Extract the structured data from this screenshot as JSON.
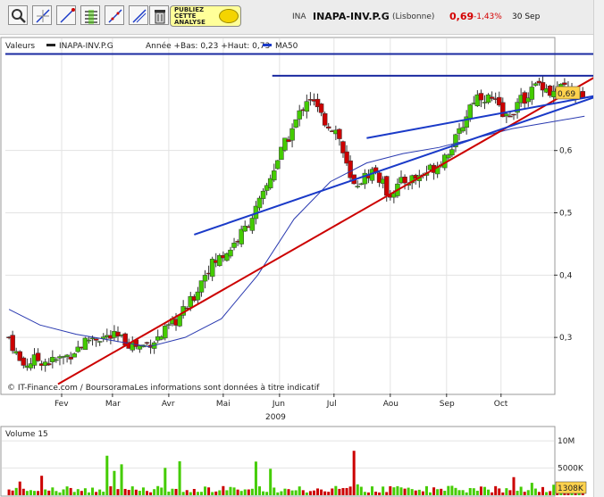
{
  "toolbar": {
    "tools": [
      {
        "name": "zoom-tool-icon"
      },
      {
        "name": "cursor-tool-icon"
      },
      {
        "name": "line-tool-icon"
      },
      {
        "name": "parallel-lines-tool-icon"
      },
      {
        "name": "fibonacci-tool-icon"
      },
      {
        "name": "move-tool-icon"
      },
      {
        "name": "pencil-tool-icon"
      },
      {
        "name": "trash-icon"
      }
    ],
    "ad": {
      "line1": "PUBLIEZ",
      "line2": "CETTE",
      "line3": "ANALYSE"
    }
  },
  "header": {
    "code": "INA",
    "name": "INAPA-INV.P.G",
    "exchange": "(Lisbonne)",
    "price": "0,69",
    "change": "-1,43%",
    "date": "30 Sep",
    "price_color": "#d40000"
  },
  "legend": {
    "valeurs": "Valeurs",
    "series_name": "INAPA-INV.P.G",
    "range_text": "Année +Bas: 0,23 +Haut: 0,73",
    "ma_label": "MA50"
  },
  "price_tag": "0,69",
  "credit": "© IT-Finance.com / BoursoramaLes informations sont données à titre indicatif",
  "volume_panel": {
    "label": "Volume 15",
    "current_value": "1308K"
  },
  "colors": {
    "up": "#44cc00",
    "down": "#cc0000",
    "trend_red": "#cc0000",
    "trend_blue": "#1a3ac8",
    "ma": "#2a3ab0",
    "tag_bg": "#ffd24d"
  },
  "chart_data": {
    "type": "candlestick",
    "year": "2009",
    "x_tick_labels": [
      "Fev",
      "Mar",
      "Avr",
      "Mai",
      "Jun",
      "Jul",
      "Aou",
      "Sep",
      "Oct"
    ],
    "x_tick_days": [
      32,
      60,
      91,
      121,
      152,
      182,
      213,
      244,
      274
    ],
    "x_range_days": [
      1,
      282
    ],
    "y_range": [
      0.21,
      0.78
    ],
    "y_ticks": [
      0.3,
      0.4,
      0.5,
      0.6
    ],
    "y_tick_labels": [
      "0,3",
      "0,4",
      "0,5",
      "0,6"
    ],
    "grid": true,
    "legend_position": "top-left",
    "price_series": {
      "name": "INAPA-INV.P.G",
      "close_points": [
        [
          3,
          0.3
        ],
        [
          10,
          0.255
        ],
        [
          18,
          0.265
        ],
        [
          26,
          0.26
        ],
        [
          35,
          0.27
        ],
        [
          48,
          0.3
        ],
        [
          62,
          0.3
        ],
        [
          75,
          0.285
        ],
        [
          86,
          0.3
        ],
        [
          96,
          0.33
        ],
        [
          104,
          0.36
        ],
        [
          112,
          0.41
        ],
        [
          124,
          0.44
        ],
        [
          132,
          0.47
        ],
        [
          142,
          0.52
        ],
        [
          150,
          0.58
        ],
        [
          160,
          0.64
        ],
        [
          168,
          0.69
        ],
        [
          176,
          0.65
        ],
        [
          184,
          0.63
        ],
        [
          192,
          0.54
        ],
        [
          196,
          0.55
        ],
        [
          204,
          0.57
        ],
        [
          212,
          0.53
        ],
        [
          220,
          0.55
        ],
        [
          230,
          0.56
        ],
        [
          240,
          0.58
        ],
        [
          250,
          0.62
        ],
        [
          258,
          0.68
        ],
        [
          262,
          0.69
        ],
        [
          270,
          0.68
        ],
        [
          276,
          0.65
        ],
        [
          282,
          0.67
        ],
        [
          292,
          0.7
        ],
        [
          296,
          0.71
        ],
        [
          302,
          0.69
        ],
        [
          308,
          0.7
        ],
        [
          314,
          0.69
        ],
        [
          320,
          0.68
        ]
      ],
      "high": 0.73,
      "low": 0.23,
      "last": 0.69
    },
    "ma50": {
      "name": "MA50",
      "points": [
        [
          3,
          0.345
        ],
        [
          20,
          0.32
        ],
        [
          40,
          0.305
        ],
        [
          60,
          0.295
        ],
        [
          80,
          0.285
        ],
        [
          100,
          0.3
        ],
        [
          120,
          0.33
        ],
        [
          140,
          0.4
        ],
        [
          160,
          0.49
        ],
        [
          180,
          0.55
        ],
        [
          200,
          0.58
        ],
        [
          220,
          0.595
        ],
        [
          240,
          0.605
        ],
        [
          260,
          0.62
        ],
        [
          280,
          0.635
        ],
        [
          300,
          0.645
        ],
        [
          320,
          0.655
        ]
      ]
    },
    "trendlines": [
      {
        "color": "red",
        "from": [
          30,
          0.225
        ],
        "to": [
          330,
          0.725
        ]
      },
      {
        "color": "blue",
        "from": [
          105,
          0.465
        ],
        "to": [
          330,
          0.69
        ]
      },
      {
        "color": "blue",
        "from": [
          200,
          0.62
        ],
        "to": [
          330,
          0.69
        ]
      },
      {
        "color": "navy",
        "from": [
          1,
          0.755
        ],
        "to": [
          330,
          0.755
        ],
        "label": "horizontal resistance"
      },
      {
        "color": "navy",
        "from": [
          148,
          0.72
        ],
        "to": [
          330,
          0.72
        ],
        "label": "horizontal resistance"
      }
    ],
    "volume": {
      "y_ticks_labels": [
        "10M",
        "5000K"
      ],
      "y_ticks_values": [
        10000000,
        5000000
      ],
      "max": 12000000
    }
  }
}
